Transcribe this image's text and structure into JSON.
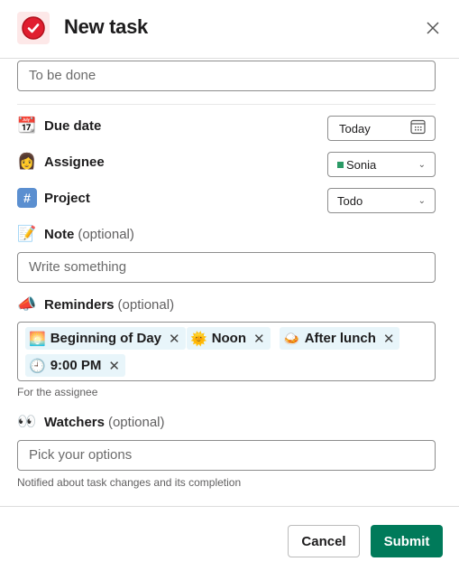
{
  "header": {
    "title": "New task",
    "app_icon": "check-circle-icon",
    "close_icon": "close-icon"
  },
  "task_title": {
    "placeholder": "To be done"
  },
  "due_date": {
    "icon": "calendar-emoji",
    "emoji": "📆",
    "label": "Due date",
    "value": "Today",
    "picker_icon": "calendar-icon"
  },
  "assignee": {
    "icon": "woman-emoji",
    "emoji": "👩",
    "label": "Assignee",
    "value": "Sonia"
  },
  "project": {
    "icon": "hash-emoji",
    "emoji": "#️⃣",
    "label": "Project",
    "value": "Todo"
  },
  "note": {
    "icon": "memo-emoji",
    "emoji": "📝",
    "label": "Note",
    "optional": "(optional)",
    "placeholder": "Write something"
  },
  "reminders": {
    "icon": "loudspeaker-emoji",
    "emoji": "📣",
    "label": "Reminders",
    "optional": "(optional)",
    "chips": [
      {
        "emoji": "🌅",
        "label": "Beginning of Day"
      },
      {
        "emoji": "🌞",
        "label": "Noon"
      },
      {
        "emoji": "🍛",
        "label": "After lunch"
      },
      {
        "emoji": "🕘",
        "label": "9:00 PM"
      }
    ],
    "hint": "For the assignee"
  },
  "watchers": {
    "icon": "eyes-emoji",
    "emoji": "👀",
    "label": "Watchers",
    "optional": "(optional)",
    "placeholder": "Pick your options",
    "hint": "Notified about task changes and its completion"
  },
  "footer": {
    "cancel_label": "Cancel",
    "submit_label": "Submit"
  },
  "colors": {
    "accent": "#007a5a",
    "app_icon": "#e01e2f",
    "chip_bg": "#e8f5fa"
  }
}
